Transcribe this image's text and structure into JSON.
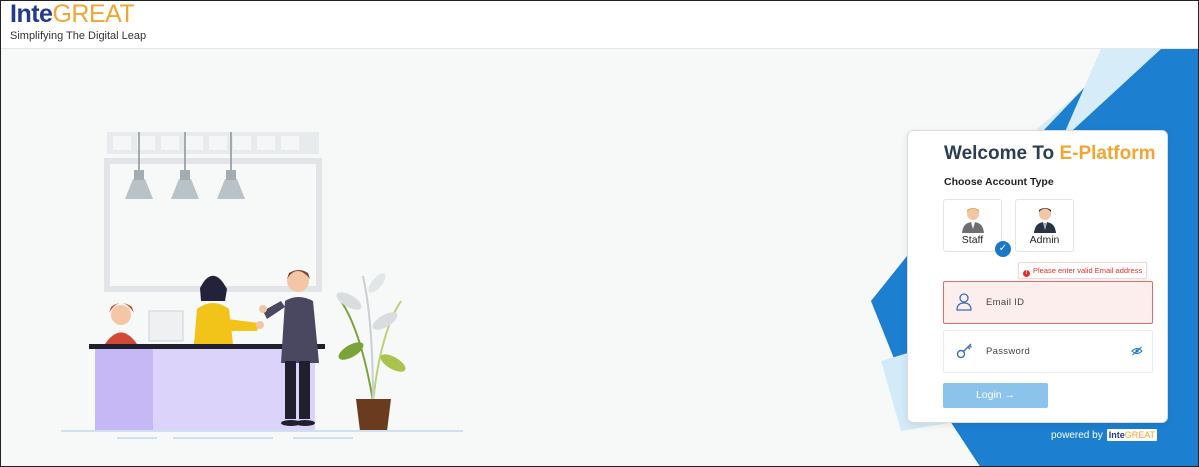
{
  "brand": {
    "logo_inte": "Inte",
    "logo_great": "GREAT",
    "tagline": "Simplifying The Digital Leap"
  },
  "login": {
    "welcome_prefix": "Welcome To ",
    "welcome_accent": "E-Platform",
    "choose_label": "Choose Account Type",
    "account_types": [
      {
        "label": "Staff",
        "selected": true
      },
      {
        "label": "Admin",
        "selected": false
      }
    ],
    "error_message": "Please enter valid Email address",
    "email_placeholder": "Email ID",
    "password_placeholder": "Password",
    "login_label": "Login →",
    "powered_by": "powered by",
    "powered_logo_inte": "Inte",
    "powered_logo_great": "GREAT"
  },
  "colors": {
    "accent_orange": "#f2a531",
    "brand_navy": "#243a8c",
    "primary_blue": "#1a78c9",
    "error_red": "#e0312b"
  }
}
